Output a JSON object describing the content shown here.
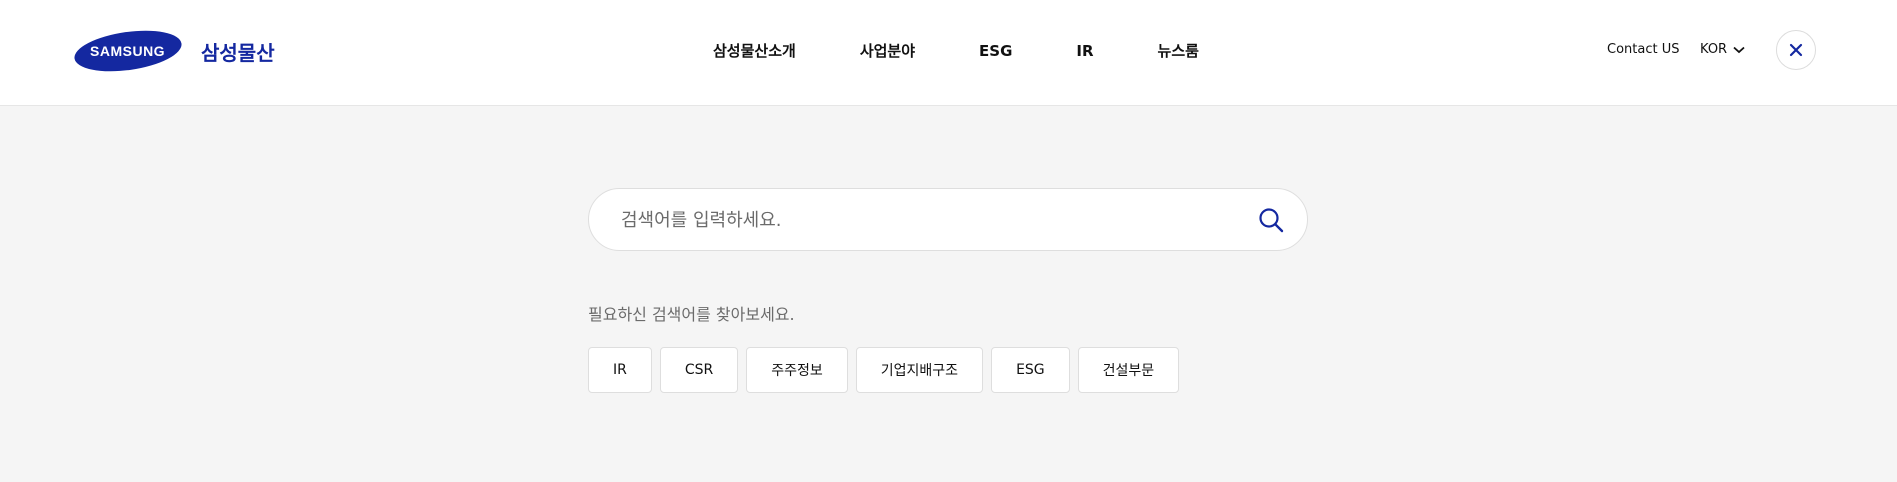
{
  "brand": {
    "logo_wordmark": "SAMSUNG",
    "company_name": "삼성물산",
    "color": "#1428a0"
  },
  "nav": {
    "items": [
      {
        "label": "삼성물산소개"
      },
      {
        "label": "사업분야"
      },
      {
        "label": "ESG"
      },
      {
        "label": "IR"
      },
      {
        "label": "뉴스룸"
      }
    ]
  },
  "utility": {
    "contact_label": "Contact US",
    "language_label": "KOR",
    "language_icon": "chevron-down-icon",
    "close_icon": "close-icon"
  },
  "search": {
    "placeholder": "검색어를 입력하세요.",
    "value": "",
    "icon": "search-icon"
  },
  "suggestions": {
    "title": "필요하신 검색어를 찾아보세요.",
    "tags": [
      {
        "label": "IR"
      },
      {
        "label": "CSR"
      },
      {
        "label": "주주정보"
      },
      {
        "label": "기업지배구조"
      },
      {
        "label": "ESG"
      },
      {
        "label": "건설부문"
      }
    ]
  }
}
